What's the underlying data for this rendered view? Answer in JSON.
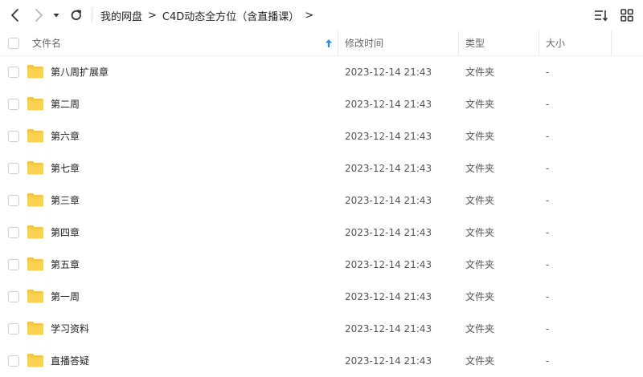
{
  "toolbar": {
    "breadcrumb": [
      "我的网盘",
      "C4D动态全方位（含直播课）"
    ],
    "breadcrumb_separator": ">"
  },
  "columns": {
    "name": "文件名",
    "modified": "修改时间",
    "type": "类型",
    "size": "大小"
  },
  "colors": {
    "folder": "#f9c63a",
    "sort_arrow": "#2e8ae6"
  },
  "files": [
    {
      "name": "第八周扩展章",
      "modified": "2023-12-14 21:43",
      "type": "文件夹",
      "size": "-"
    },
    {
      "name": "第二周",
      "modified": "2023-12-14 21:43",
      "type": "文件夹",
      "size": "-"
    },
    {
      "name": "第六章",
      "modified": "2023-12-14 21:43",
      "type": "文件夹",
      "size": "-"
    },
    {
      "name": "第七章",
      "modified": "2023-12-14 21:43",
      "type": "文件夹",
      "size": "-"
    },
    {
      "name": "第三章",
      "modified": "2023-12-14 21:43",
      "type": "文件夹",
      "size": "-"
    },
    {
      "name": "第四章",
      "modified": "2023-12-14 21:43",
      "type": "文件夹",
      "size": "-"
    },
    {
      "name": "第五章",
      "modified": "2023-12-14 21:43",
      "type": "文件夹",
      "size": "-"
    },
    {
      "name": "第一周",
      "modified": "2023-12-14 21:43",
      "type": "文件夹",
      "size": "-"
    },
    {
      "name": "学习资料",
      "modified": "2023-12-14 21:43",
      "type": "文件夹",
      "size": "-"
    },
    {
      "name": "直播答疑",
      "modified": "2023-12-14 21:43",
      "type": "文件夹",
      "size": "-"
    }
  ]
}
